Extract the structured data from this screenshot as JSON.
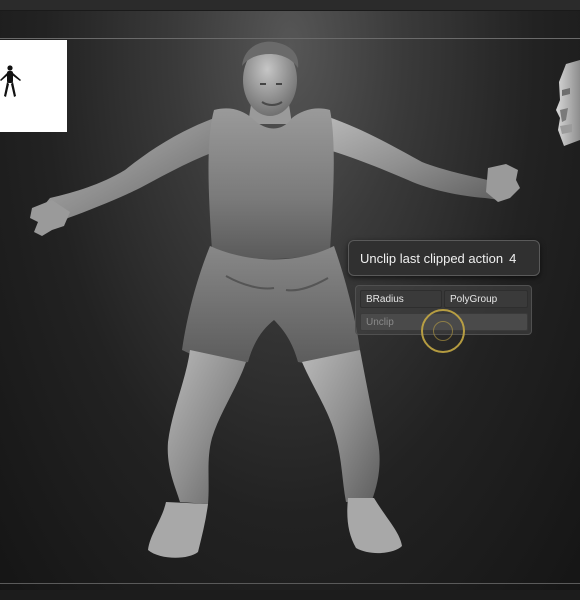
{
  "tooltip": {
    "label": "Unclip last clipped action",
    "count": "4"
  },
  "palette": {
    "buttons": [
      {
        "label": "BRadius"
      },
      {
        "label": "PolyGroup"
      },
      {
        "label": "Unclip"
      }
    ]
  },
  "icons": [
    "figure-silhouette-icon",
    "head-navigation-icon",
    "brush-cursor-icon"
  ],
  "colors": {
    "background": "#262626",
    "tooltip_bg": "#303030",
    "cursor_ring": "#c4a844",
    "model": "#8a8a8a"
  }
}
